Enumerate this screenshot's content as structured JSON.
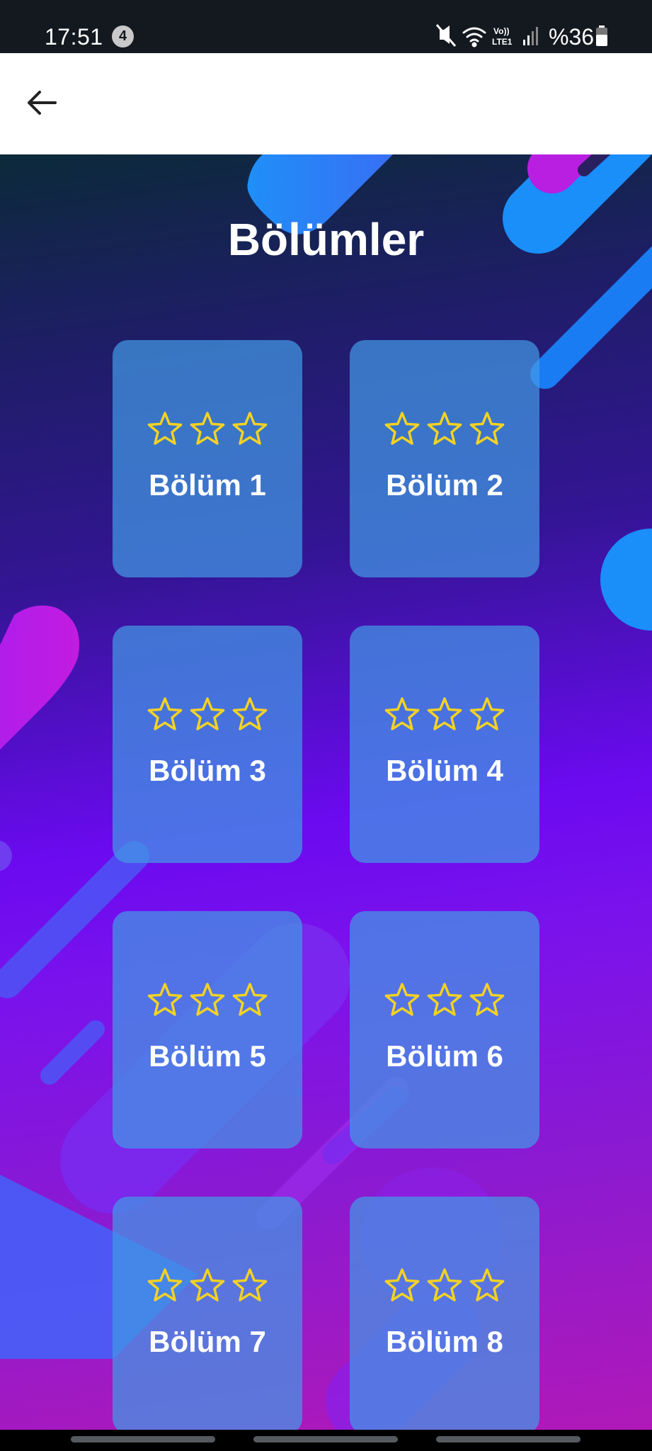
{
  "status_bar": {
    "time": "17:51",
    "notification_count": "4",
    "network_label_top": "Vo))",
    "network_label_bottom": "LTE1",
    "battery_text": "%36",
    "icons": [
      "mute-icon",
      "wifi-icon",
      "signal-icon",
      "battery-icon"
    ]
  },
  "app_bar": {
    "back_icon": "arrow-left-icon"
  },
  "page": {
    "title": "Bölümler"
  },
  "levels": [
    {
      "label": "Bölüm 1",
      "stars_earned": 0,
      "stars_total": 3
    },
    {
      "label": "Bölüm 2",
      "stars_earned": 0,
      "stars_total": 3
    },
    {
      "label": "Bölüm 3",
      "stars_earned": 0,
      "stars_total": 3
    },
    {
      "label": "Bölüm 4",
      "stars_earned": 0,
      "stars_total": 3
    },
    {
      "label": "Bölüm 5",
      "stars_earned": 0,
      "stars_total": 3
    },
    {
      "label": "Bölüm 6",
      "stars_earned": 0,
      "stars_total": 3
    },
    {
      "label": "Bölüm 7",
      "stars_earned": 0,
      "stars_total": 3
    },
    {
      "label": "Bölüm 8",
      "stars_earned": 0,
      "stars_total": 3
    }
  ],
  "colors": {
    "star_outline": "#f3d224",
    "card_fill": "#4298e4",
    "status_bar": "#141920",
    "app_bar": "#ffffff"
  }
}
